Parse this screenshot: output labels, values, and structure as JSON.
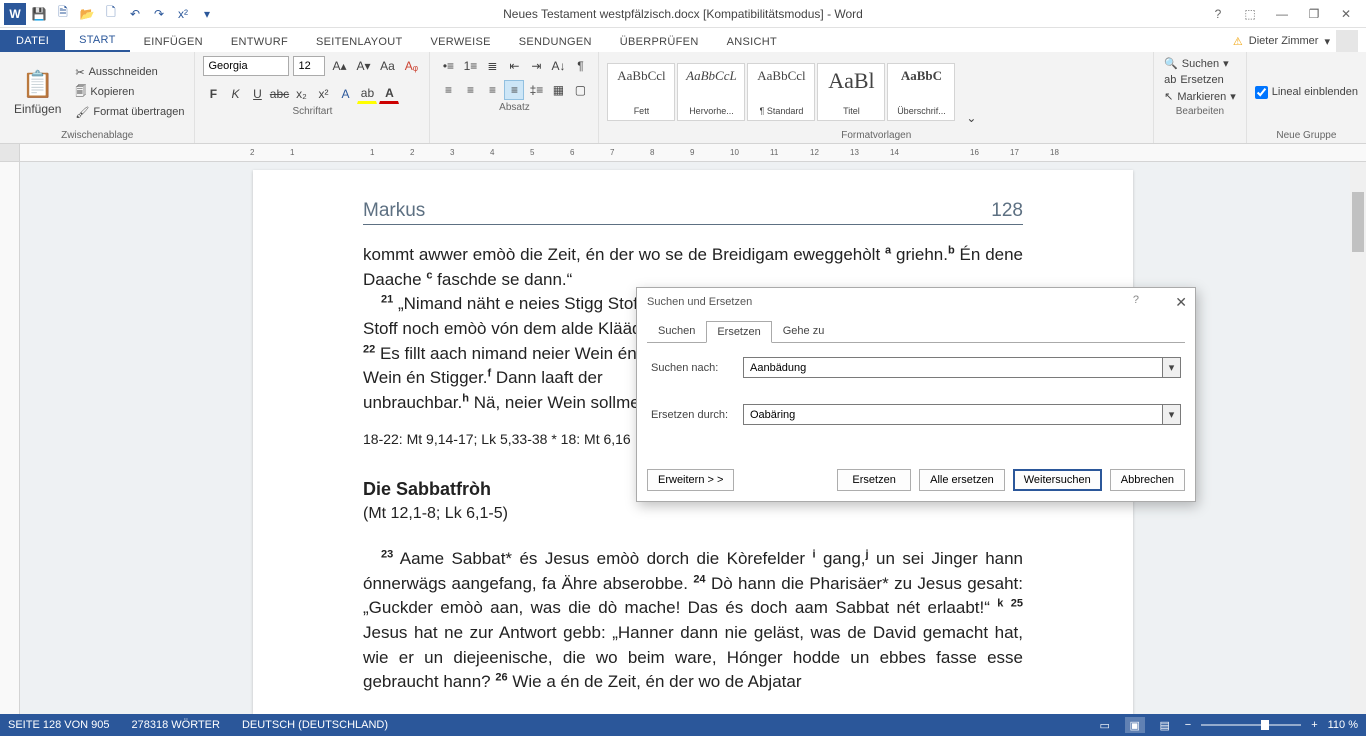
{
  "titlebar": {
    "logo": "W",
    "title": "Neues Testament westpfälzisch.docx [Kompatibilitätsmodus] - Word"
  },
  "user": {
    "name": "Dieter Zimmer"
  },
  "tabs": {
    "file": "DATEI",
    "items": [
      "START",
      "EINFÜGEN",
      "ENTWURF",
      "SEITENLAYOUT",
      "VERWEISE",
      "SENDUNGEN",
      "ÜBERPRÜFEN",
      "ANSICHT"
    ],
    "active": "START"
  },
  "ribbon": {
    "clipboard": {
      "paste": "Einfügen",
      "cut": "Ausschneiden",
      "copy": "Kopieren",
      "format": "Format übertragen",
      "label": "Zwischenablage"
    },
    "font": {
      "name": "Georgia",
      "size": "12",
      "label": "Schriftart"
    },
    "para": {
      "label": "Absatz"
    },
    "styles": {
      "label": "Formatvorlagen",
      "items": [
        {
          "prev": "AaBbCcl",
          "name": "Fett"
        },
        {
          "prev": "AaBbCcL",
          "name": "Hervorhe..."
        },
        {
          "prev": "AaBbCcl",
          "name": "¶ Standard"
        },
        {
          "prev": "AaBl",
          "name": "Titel"
        },
        {
          "prev": "AaBbC",
          "name": "Überschrif..."
        }
      ]
    },
    "editing": {
      "find": "Suchen",
      "replace": "Ersetzen",
      "select": "Markieren",
      "label": "Bearbeiten"
    },
    "newgroup": {
      "ruler": "Lineal einblenden",
      "label": "Neue Gruppe"
    }
  },
  "doc": {
    "header_left": "Markus",
    "header_right": "128",
    "p1a": "kommt awwer emòò die Zeit, én der wo se de Breidigam eweggehòlt ",
    "p1b": " griehn.",
    "p1c": " Én dene Daache ",
    "p1d": " faschde se dann.“",
    "p2a": " „Nimand näht e neies Stigg Stoff",
    "p2b": " Stoff noch emòò vón dem alde Klääd ab",
    "p3a": " Es fillt aach nimand neier Wein én a",
    "p3b": " Wein én Stigger.",
    "p3c": " Dann laaft der",
    "p3d": " unbrauchbar.",
    "p3e": " Nä, neier Wein sollmer e",
    "xref": "18-22: Mt 9,14-17; Lk 5,33-38 * 18: Mt 6,16",
    "h3": "Die Sabbatfròh",
    "sub": "(Mt 12,1-8; Lk 6,1-5)",
    "p4a": " Aame Sabbat* és Jesus emòò dorch die Kòrefelder ",
    "p4b": " gang,",
    "p4c": " un sei Jinger hann ónnerwägs aangefang, fa Ähre abserobbe. ",
    "p4d": " Dò hann die Pharisäer* zu Jesus gesaht: „Guckder emòò aan, was die dò mache! Das és doch aam Sabbat nét erlaabt!“ ",
    "p4e": " Jesus hat ne zur Antwort gebb: „Hanner dann nie geläst, was de David gemacht hat, wie er un diejeenische, die wo beim ware, Hónger hodde un ebbes fasse esse gebraucht hann? ",
    "p4f": " Wie a én de Zeit, én der wo de Abjatar"
  },
  "dialog": {
    "title": "Suchen und Ersetzen",
    "tabs": {
      "find": "Suchen",
      "replace": "Ersetzen",
      "goto": "Gehe zu"
    },
    "find_label": "Suchen nach:",
    "find_value": "Aanbädung",
    "replace_label": "Ersetzen durch:",
    "replace_value": "Oabäring",
    "more": "Erweitern > >",
    "btn_replace": "Ersetzen",
    "btn_replace_all": "Alle ersetzen",
    "btn_find_next": "Weitersuchen",
    "btn_cancel": "Abbrechen"
  },
  "status": {
    "page": "SEITE 128 VON 905",
    "words": "278318 WÖRTER",
    "lang": "DEUTSCH (DEUTSCHLAND)",
    "zoom": "110 %"
  }
}
